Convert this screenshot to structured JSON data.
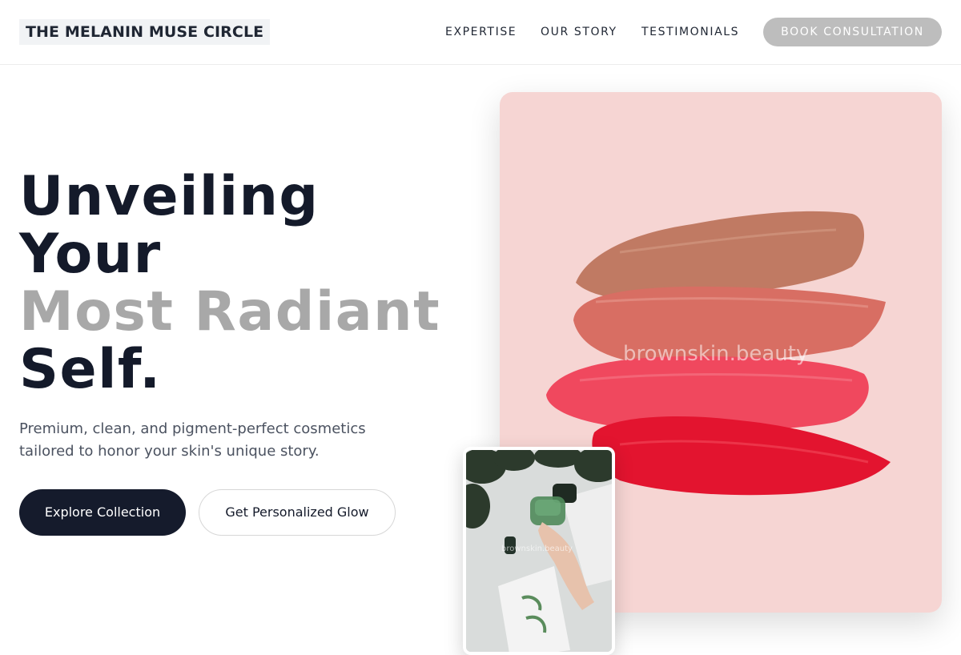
{
  "brand": {
    "name": "THE MELANIN MUSE CIRCLE"
  },
  "nav": {
    "items": [
      "EXPERTISE",
      "OUR STORY",
      "TESTIMONIALS"
    ],
    "cta_label": "BOOK CONSULTATION"
  },
  "hero": {
    "title_line1": "Unveiling",
    "title_line2": "Your",
    "title_line3": "Most Radiant",
    "title_line4": "Self.",
    "subtitle": "Premium, clean, and pigment-perfect cosmetics tailored to honor your skin's unique story.",
    "primary_button": "Explore Collection",
    "secondary_button": "Get Personalized Glow"
  },
  "images": {
    "main_watermark": "brownskin.beauty",
    "small_watermark": "brownskin.beauty"
  },
  "colors": {
    "accent_dark": "#151b2c",
    "muted_title": "#a8a8a8",
    "card_background": "#f6d5d3",
    "cta_background": "#bdbdbd"
  }
}
